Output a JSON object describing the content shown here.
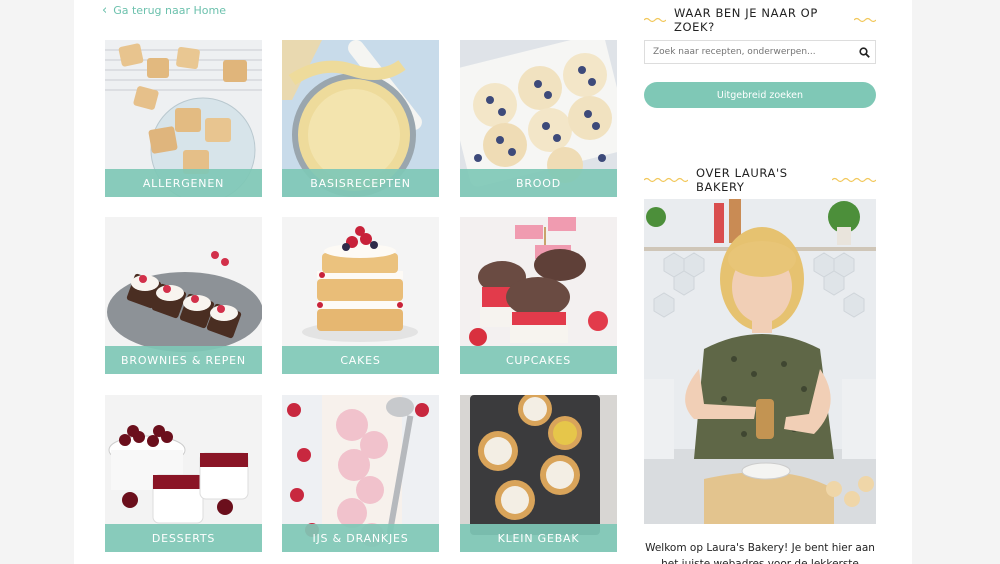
{
  "nav": {
    "back_label": "Ga terug naar Home"
  },
  "categories": [
    {
      "label": "ALLERGENEN",
      "icon": "shortbread-cookies-image"
    },
    {
      "label": "BASISRECEPTEN",
      "icon": "pie-crust-image"
    },
    {
      "label": "BROOD",
      "icon": "blueberry-rolls-image"
    },
    {
      "label": "BROWNIES & REPEN",
      "icon": "brownie-bars-image"
    },
    {
      "label": "CAKES",
      "icon": "layer-cake-image"
    },
    {
      "label": "CUPCAKES",
      "icon": "cupcakes-image"
    },
    {
      "label": "DESSERTS",
      "icon": "cherry-desserts-image"
    },
    {
      "label": "IJS & DRANKJES",
      "icon": "ice-cream-image"
    },
    {
      "label": "KLEIN GEBAK",
      "icon": "tartlets-image"
    }
  ],
  "sidebar": {
    "search_heading": "WAAR BEN JE NAAR OP ZOEK?",
    "search_placeholder": "Zoek naar recepten, onderwerpen...",
    "advanced_button": "Uitgebreid zoeken",
    "about_heading": "OVER LAURA'S BAKERY",
    "welcome_text": "Welkom op Laura's Bakery! Je bent hier aan het juiste webadres voor de lekkerste baksels en"
  },
  "colors": {
    "accent": "#7fc8b6",
    "link": "#6cc1ad",
    "heading_wave": "#f2c85b"
  }
}
